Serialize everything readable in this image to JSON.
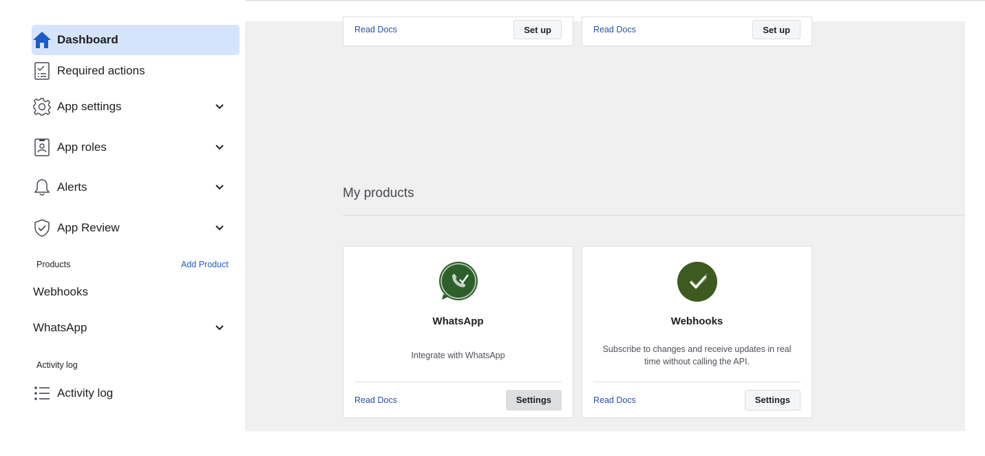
{
  "sidebar": {
    "nav": [
      {
        "label": "Dashboard",
        "icon": "home-icon",
        "active": true
      },
      {
        "label": "Required actions",
        "icon": "checklist-icon"
      },
      {
        "label": "App settings",
        "icon": "gear-icon"
      },
      {
        "label": "App roles",
        "icon": "id-badge-icon"
      },
      {
        "label": "Alerts",
        "icon": "bell-icon"
      },
      {
        "label": "App Review",
        "icon": "shield-check-icon"
      }
    ],
    "products_label": "Products",
    "add_product_label": "Add Product",
    "products": [
      {
        "label": "Webhooks"
      },
      {
        "label": "WhatsApp"
      }
    ],
    "activity_section_label": "Activity log",
    "activity_item": {
      "label": "Activity log",
      "icon": "list-icon"
    }
  },
  "top_cards": [
    {
      "read_docs": "Read Docs",
      "button": "Set up"
    },
    {
      "read_docs": "Read Docs",
      "button": "Set up"
    }
  ],
  "my_products": {
    "title": "My products",
    "cards": [
      {
        "name": "WhatsApp",
        "description": "Integrate with WhatsApp",
        "icon": "whatsapp-icon",
        "read_docs": "Read Docs",
        "button": "Settings"
      },
      {
        "name": "Webhooks",
        "description": "Subscribe to changes and receive updates in real time without calling the API.",
        "icon": "webhooks-icon",
        "read_docs": "Read Docs",
        "button": "Settings"
      }
    ]
  },
  "colors": {
    "accent": "#1a5dc8",
    "active_nav_bg": "#d6e4fb",
    "link": "#2452a3",
    "whatsapp_icon": "#2d5f2a",
    "webhooks_icon": "#3d5a1f",
    "main_bg": "#f0f0f0"
  }
}
